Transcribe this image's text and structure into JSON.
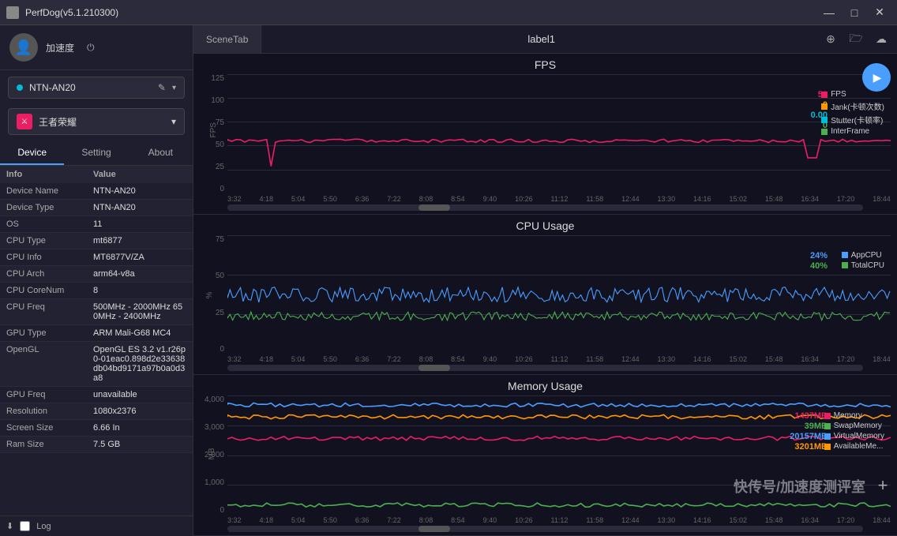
{
  "titlebar": {
    "title": "PerfDog(v5.1.210300)",
    "icon": "perfdog-icon",
    "controls": [
      "minimize",
      "maximize",
      "close"
    ]
  },
  "sidebar": {
    "user": {
      "name": "加速度",
      "power_label": "⏻"
    },
    "device_selector": {
      "device": "NTN-AN20",
      "dot_color": "#00bcd4"
    },
    "app_selector": {
      "app": "王者荣耀"
    },
    "tabs": [
      "Device",
      "Setting",
      "About"
    ],
    "active_tab": "Device",
    "info_header": [
      "Info",
      "Value"
    ],
    "info_rows": [
      {
        "label": "Device Name",
        "value": "NTN-AN20"
      },
      {
        "label": "Device Type",
        "value": "NTN-AN20"
      },
      {
        "label": "OS",
        "value": "11"
      },
      {
        "label": "CPU Type",
        "value": "mt6877"
      },
      {
        "label": "CPU Info",
        "value": "MT6877V/ZA"
      },
      {
        "label": "CPU Arch",
        "value": "arm64-v8a"
      },
      {
        "label": "CPU CoreNum",
        "value": "8"
      },
      {
        "label": "CPU Freq",
        "value": "500MHz - 2000MHz\n650MHz - 2400MHz"
      },
      {
        "label": "GPU Type",
        "value": "ARM Mali-G68 MC4"
      },
      {
        "label": "OpenGL",
        "value": "OpenGL ES 3.2 v1.r26p0-01eac0.898d2e33638db04bd9171a97b0a0d3a8"
      },
      {
        "label": "GPU Freq",
        "value": "unavailable"
      },
      {
        "label": "Resolution",
        "value": "1080x2376"
      },
      {
        "label": "Screen Size",
        "value": "6.66 In"
      },
      {
        "label": "Ram Size",
        "value": "7.5 GB"
      }
    ],
    "bottom": {
      "down_icon": "⬇",
      "log_label": "Log"
    }
  },
  "content": {
    "scene_tab": "SceneTab",
    "label": "label1",
    "header_icons": [
      "location-icon",
      "folder-icon",
      "cloud-icon"
    ],
    "charts": [
      {
        "id": "fps",
        "title": "FPS",
        "y_axis_label": "FPS",
        "y_max": 125,
        "y_labels": [
          "125",
          "100",
          "75",
          "50",
          "25",
          "0"
        ],
        "x_labels": [
          "3:32",
          "4:18",
          "5:04",
          "5:50",
          "6:36",
          "7:22",
          "8:08",
          "8:54",
          "9:40",
          "10:26",
          "11:12",
          "11:58",
          "12:44",
          "13:30",
          "14:16",
          "15:02",
          "15:48",
          "16:34",
          "17:20",
          "18:44"
        ],
        "values": {
          "current": [
            "59",
            "0",
            "0.00",
            "0"
          ],
          "value_colors": [
            "#e91e63",
            "#ff9800",
            "#00bcd4",
            "#4caf50"
          ]
        },
        "legend": [
          {
            "label": "FPS",
            "color": "#e91e63"
          },
          {
            "label": "Jank(卡顿次数)",
            "color": "#ff9800"
          },
          {
            "label": "Stutter(卡顿率)",
            "color": "#00bcd4"
          },
          {
            "label": "InterFrame",
            "color": "#4caf50"
          }
        ],
        "scrollbar": {
          "left": "30%",
          "width": "5%"
        }
      },
      {
        "id": "cpu",
        "title": "CPU Usage",
        "y_axis_label": "%",
        "y_labels": [
          "75",
          "50",
          "25",
          "0"
        ],
        "x_labels": [
          "3:32",
          "4:18",
          "5:04",
          "5:50",
          "6:36",
          "7:22",
          "8:08",
          "8:54",
          "9:40",
          "10:26",
          "11:12",
          "11:58",
          "12:44",
          "13:30",
          "14:16",
          "15:02",
          "15:48",
          "16:34",
          "17:20",
          "18:44"
        ],
        "values": {
          "current": [
            "24%",
            "40%"
          ],
          "value_colors": [
            "#4a9eff",
            "#4caf50"
          ]
        },
        "legend": [
          {
            "label": "AppCPU",
            "color": "#4a9eff"
          },
          {
            "label": "TotalCPU",
            "color": "#4caf50"
          }
        ],
        "scrollbar": {
          "left": "30%",
          "width": "5%"
        }
      },
      {
        "id": "memory",
        "title": "Memory Usage",
        "y_axis_label": "MB",
        "y_labels": [
          "4,000",
          "3,000",
          "2,000",
          "1,000",
          "0"
        ],
        "x_labels": [
          "3:32",
          "4:18",
          "5:04",
          "5:50",
          "6:36",
          "7:22",
          "8:08",
          "8:54",
          "9:40",
          "10:26",
          "11:12",
          "11:58",
          "12:44",
          "13:30",
          "14:16",
          "15:02",
          "15:48",
          "16:34",
          "17:20",
          "18:44"
        ],
        "values": {
          "current": [
            "1437MB",
            "39MB",
            "20157MB",
            "3201MB"
          ],
          "value_colors": [
            "#e91e63",
            "#4caf50",
            "#4a9eff",
            "#ff9800"
          ]
        },
        "legend": [
          {
            "label": "Memory",
            "color": "#e91e63"
          },
          {
            "label": "SwapMemory",
            "color": "#4caf50"
          },
          {
            "label": "VirtualMemory",
            "color": "#4a9eff"
          },
          {
            "label": "AvailableMe...",
            "color": "#ff9800"
          }
        ],
        "scrollbar": {
          "left": "30%",
          "width": "5%"
        }
      }
    ]
  },
  "watermark": "快传号/加速度测评室"
}
